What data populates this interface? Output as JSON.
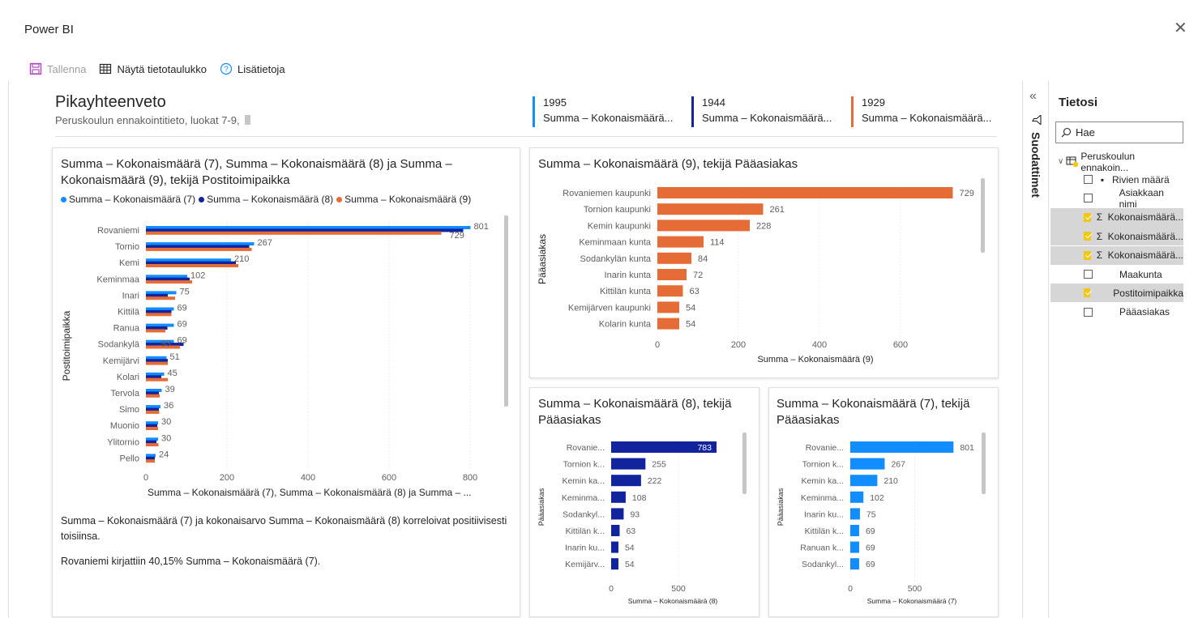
{
  "app": {
    "title": "Power BI",
    "close_glyph": "✕"
  },
  "toolbar": {
    "save_label": "Tallenna",
    "table_label": "Näytä tietotaulukko",
    "info_label": "Lisätietoja"
  },
  "summary": {
    "title": "Pikayhteenveto",
    "subtitle": "Peruskoulun ennakointitieto, luokat 7-9,"
  },
  "kpis": [
    {
      "value": "1995",
      "label": "Summa – Kokonaismäärä...",
      "color": "#118dff"
    },
    {
      "value": "1944",
      "label": "Summa – Kokonaismäärä...",
      "color": "#12239e"
    },
    {
      "value": "1929",
      "label": "Summa – Kokonaismäärä...",
      "color": "#e66c37"
    }
  ],
  "colors": {
    "s7": "#118dff",
    "s8": "#12239e",
    "s9": "#e66c37"
  },
  "main_chart": {
    "title_line1": "Summa – Kokonaismäärä (7), Summa – Kokonaismäärä (8) ja Summa –",
    "title_line2": "Kokonaismäärä (9), tekijä Postitoimipaikka",
    "legend": [
      "Summa – Kokonaismäärä (7)",
      "Summa – Kokonaismäärä (8)",
      "Summa – Kokonaismäärä (9)"
    ],
    "ylabel": "Postitoimipaikka",
    "xlabel": "Summa – Kokonaismäärä (7), Summa – Kokonaismäärä (8) ja Summa – ...",
    "xticks": [
      "0",
      "200",
      "400",
      "600",
      "800"
    ]
  },
  "insights": {
    "line1": "Summa – Kokonaismäärä (7) ja kokonaisarvo Summa – Kokonaismäärä (8) korreloivat positiivisesti",
    "line2": "toisiinsa.",
    "line3": "Rovaniemi kirjattiin 40,15% Summa – Kokonaismäärä (7)."
  },
  "chart9": {
    "title": "Summa – Kokonaismäärä (9), tekijä Pääasiakas",
    "ylabel": "Pääasiakas",
    "xlabel": "Summa – Kokonaismäärä (9)",
    "xticks": [
      "0",
      "200",
      "400",
      "600"
    ]
  },
  "chart8": {
    "title_line1": "Summa – Kokonaismäärä (8), tekijä",
    "title_line2": "Pääasiakas",
    "ylabel": "Pääasiakas",
    "xlabel": "Summa – Kokonaismäärä (8)",
    "xticks": [
      "0",
      "500"
    ]
  },
  "chart7": {
    "title_line1": "Summa – Kokonaismäärä (7), tekijä",
    "title_line2": "Pääasiakas",
    "ylabel": "Pääasiakas",
    "xlabel": "Summa – Kokonaismäärä (7)",
    "xticks": [
      "0",
      "500"
    ]
  },
  "fields_pane": {
    "collapse_glyph": "«",
    "filters_label": "Suodattimet",
    "title": "Tietosi",
    "search_placeholder": "Hae",
    "table_name": "Peruskoulun ennakoin...",
    "fields": [
      {
        "label": "Rivien määrä",
        "checked": false,
        "icon": "calculator-icon"
      },
      {
        "label": "Asiakkaan nimi",
        "checked": false,
        "icon": ""
      },
      {
        "label": "Kokonaismäärä...",
        "checked": true,
        "icon": "sigma-icon"
      },
      {
        "label": "Kokonaismäärä...",
        "checked": true,
        "icon": "sigma-icon"
      },
      {
        "label": "Kokonaismäärä...",
        "checked": true,
        "icon": "sigma-icon"
      },
      {
        "label": "Maakunta",
        "checked": false,
        "icon": ""
      },
      {
        "label": "Postitoimipaikka",
        "checked": true,
        "icon": ""
      },
      {
        "label": "Pääasiakas",
        "checked": false,
        "icon": ""
      }
    ]
  },
  "chart_data": [
    {
      "type": "bar",
      "title": "Summa – Kokonaismäärä (7), Summa – Kokonaismäärä (8) ja Summa – Kokonaismäärä (9), tekijä Postitoimipaikka",
      "orientation": "horizontal",
      "categories": [
        "Rovaniemi",
        "Tornio",
        "Kemi",
        "Keminmaa",
        "Inari",
        "Kittilä",
        "Ranua",
        "Sodankylä",
        "Kemijärvi",
        "Kolari",
        "Tervola",
        "Simo",
        "Muonio",
        "Ylitornio",
        "Pello"
      ],
      "series": [
        {
          "name": "Summa – Kokonaismäärä (7)",
          "values": [
            801,
            267,
            210,
            102,
            75,
            69,
            69,
            69,
            51,
            45,
            39,
            36,
            30,
            30,
            24
          ]
        },
        {
          "name": "Summa – Kokonaismäärä (8)",
          "values": [
            783,
            255,
            222,
            108,
            54,
            63,
            53,
            93,
            54,
            38,
            32,
            32,
            28,
            26,
            22
          ]
        },
        {
          "name": "Summa – Kokonaismäärä (9)",
          "values": [
            729,
            261,
            228,
            114,
            72,
            63,
            48,
            84,
            54,
            54,
            34,
            33,
            30,
            31,
            22
          ]
        }
      ],
      "data_labels": [
        "801",
        "267",
        "210",
        "102",
        "75",
        "69",
        "69",
        "69",
        "51",
        "45",
        "39",
        "36",
        "30",
        "30",
        "24"
      ],
      "data_labels_9": {
        "Rovaniemi": "729",
        "Sodankylä": "93"
      },
      "xlim": [
        0,
        850
      ],
      "grid": true
    },
    {
      "type": "bar",
      "title": "Summa – Kokonaismäärä (9), tekijä Pääasiakas",
      "orientation": "horizontal",
      "categories": [
        "Rovaniemen kaupunki",
        "Tornion kaupunki",
        "Kemin kaupunki",
        "Keminmaan kunta",
        "Sodankylän kunta",
        "Inarin kunta",
        "Kittilän kunta",
        "Kemijärven kaupunki",
        "Kolarin kunta"
      ],
      "values": [
        729,
        261,
        228,
        114,
        84,
        72,
        63,
        54,
        54
      ],
      "xlim": [
        0,
        730
      ],
      "grid": true
    },
    {
      "type": "bar",
      "title": "Summa – Kokonaismäärä (8), tekijä Pääasiakas",
      "orientation": "horizontal",
      "categories": [
        "Rovanie...",
        "Tornion k...",
        "Kemin ka...",
        "Keminma...",
        "Sodankyl...",
        "Kittilän k...",
        "Inarin ku...",
        "Kemijärv..."
      ],
      "values": [
        783,
        255,
        222,
        108,
        93,
        63,
        54,
        54
      ],
      "xlim": [
        0,
        790
      ],
      "grid": true
    },
    {
      "type": "bar",
      "title": "Summa – Kokonaismäärä (7), tekijä Pääasiakas",
      "orientation": "horizontal",
      "categories": [
        "Rovanie...",
        "Tornion k...",
        "Kemin ka...",
        "Keminma...",
        "Inarin ku...",
        "Kittilän k...",
        "Ranuan k...",
        "Sodankyl..."
      ],
      "values": [
        801,
        267,
        210,
        102,
        75,
        69,
        69,
        69
      ],
      "xlim": [
        0,
        810
      ],
      "grid": true
    }
  ]
}
